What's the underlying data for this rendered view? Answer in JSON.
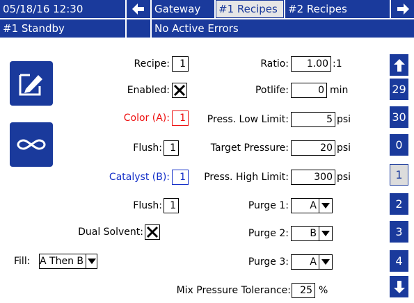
{
  "header": {
    "datetime": "05/18/16 12:30",
    "tabs": [
      {
        "label": "Gateway",
        "selected": false
      },
      {
        "label": "#1 Recipes",
        "selected": true
      },
      {
        "label": "#2 Recipes",
        "selected": false
      }
    ]
  },
  "status": {
    "mode": "#1 Standby",
    "errors": "No Active Errors"
  },
  "form": {
    "recipe": {
      "label": "Recipe:",
      "value": "1"
    },
    "enabled": {
      "label": "Enabled:",
      "checked": true
    },
    "color_a": {
      "label": "Color (A):",
      "value": "1"
    },
    "flush_a": {
      "label": "Flush:",
      "value": "1"
    },
    "catalyst_b": {
      "label": "Catalyst (B):",
      "value": "1"
    },
    "flush_b": {
      "label": "Flush:",
      "value": "1"
    },
    "dual_solvent": {
      "label": "Dual Solvent:",
      "checked": true
    },
    "fill": {
      "label": "Fill:",
      "value": "A Then B"
    },
    "ratio": {
      "label": "Ratio:",
      "value": "1.00",
      "unit": ":1"
    },
    "potlife": {
      "label": "Potlife:",
      "value": "0",
      "unit": "min"
    },
    "press_low": {
      "label": "Press. Low Limit:",
      "value": "5",
      "unit": "psi"
    },
    "target_pressure": {
      "label": "Target Pressure:",
      "value": "20",
      "unit": "psi"
    },
    "press_high": {
      "label": "Press. High Limit:",
      "value": "300",
      "unit": "psi"
    },
    "purge1": {
      "label": "Purge 1:",
      "value": "A"
    },
    "purge2": {
      "label": "Purge 2:",
      "value": "B"
    },
    "purge3": {
      "label": "Purge 3:",
      "value": "A"
    },
    "mix_tolerance": {
      "label": "Mix Pressure Tolerance:",
      "value": "25",
      "unit": "%"
    }
  },
  "sidebar": {
    "items": [
      "29",
      "30",
      "0",
      "1",
      "2",
      "3",
      "4"
    ],
    "selected": "1"
  },
  "colors": {
    "accent": "#1a3a9c",
    "color_a": "#e11111",
    "catalyst_b": "#1530c8"
  },
  "icons": [
    "left-arrow-icon",
    "right-arrow-icon",
    "edit-icon",
    "infinity-icon",
    "up-arrow-icon",
    "down-arrow-icon",
    "checkmark-x-icon",
    "dropdown-caret-icon"
  ]
}
